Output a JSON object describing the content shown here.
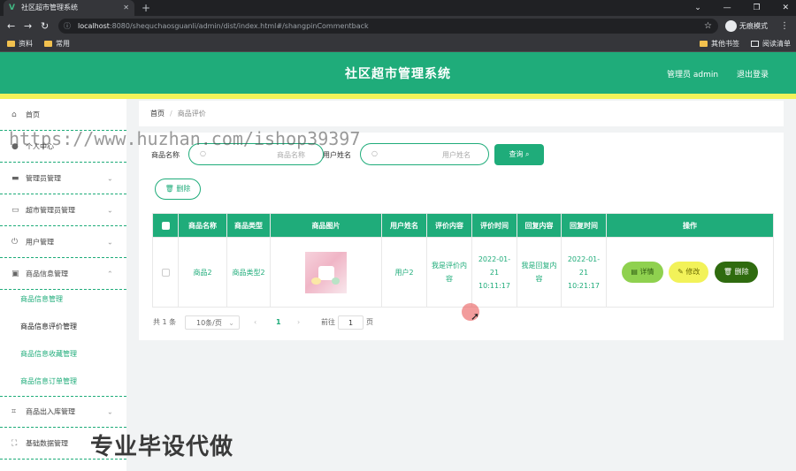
{
  "browser": {
    "tab_title": "社区超市管理系统",
    "tab_icon": "vue-logo-icon",
    "url_host": "localhost",
    "url_path": ":8080/shequchaosguanli/admin/dist/index.html#/shangpinCommentback",
    "incognito_label": "无痕模式",
    "bookmarks": [
      "资料",
      "常用"
    ],
    "bookmarks_right": [
      "其他书签",
      "阅读清单"
    ]
  },
  "header": {
    "title": "社区超市管理系统",
    "admin": "管理员 admin",
    "logout": "退出登录",
    "colors": {
      "primary": "#1fac7a",
      "accent": "#f2f259"
    }
  },
  "sidebar": {
    "items": [
      {
        "label": "首页",
        "icon": "home-icon"
      },
      {
        "label": "个人中心",
        "icon": "user-icon"
      },
      {
        "label": "管理员管理",
        "icon": "admin-icon"
      },
      {
        "label": "超市管理员管理",
        "icon": "id-card-icon"
      },
      {
        "label": "用户管理",
        "icon": "power-icon"
      },
      {
        "label": "商品信息管理",
        "icon": "chair-icon"
      },
      {
        "label": "商品出入库管理",
        "icon": "crop-icon"
      },
      {
        "label": "基础数据管理",
        "icon": "frame-icon"
      }
    ],
    "sub_items": [
      "商品信息管理",
      "商品信息评价管理",
      "商品信息收藏管理",
      "商品信息订单管理"
    ]
  },
  "overlay": {
    "watermark": "https://www.huzhan.com/ishop39397",
    "promo": "专业毕设代做"
  },
  "breadcrumb": {
    "home": "首页",
    "separator": "/",
    "current": "商品评价"
  },
  "search": {
    "product_label": "商品名称",
    "product_placeholder": "商品名称",
    "user_label": "用户姓名",
    "user_placeholder": "用户姓名",
    "query_button": "查询"
  },
  "delete_button": "删除",
  "table": {
    "headers": [
      "商品名称",
      "商品类型",
      "商品图片",
      "用户姓名",
      "评价内容",
      "评价时间",
      "回复内容",
      "回复时间",
      "操作"
    ],
    "rows": [
      {
        "name": "商品2",
        "type": "商品类型2",
        "image": "product-photo",
        "user": "用户2",
        "comment": "我是评价内容",
        "comment_time": "2022-01-21 10:11:17",
        "reply": "我是回复内容",
        "reply_time": "2022-01-21 10:21:17",
        "actions": [
          "详情",
          "修改",
          "删除"
        ]
      }
    ]
  },
  "pagination": {
    "total": "共 1 条",
    "page_size": "10条/页",
    "current_page": "1",
    "goto_label": "前往",
    "goto_value": "1",
    "page_unit": "页"
  }
}
